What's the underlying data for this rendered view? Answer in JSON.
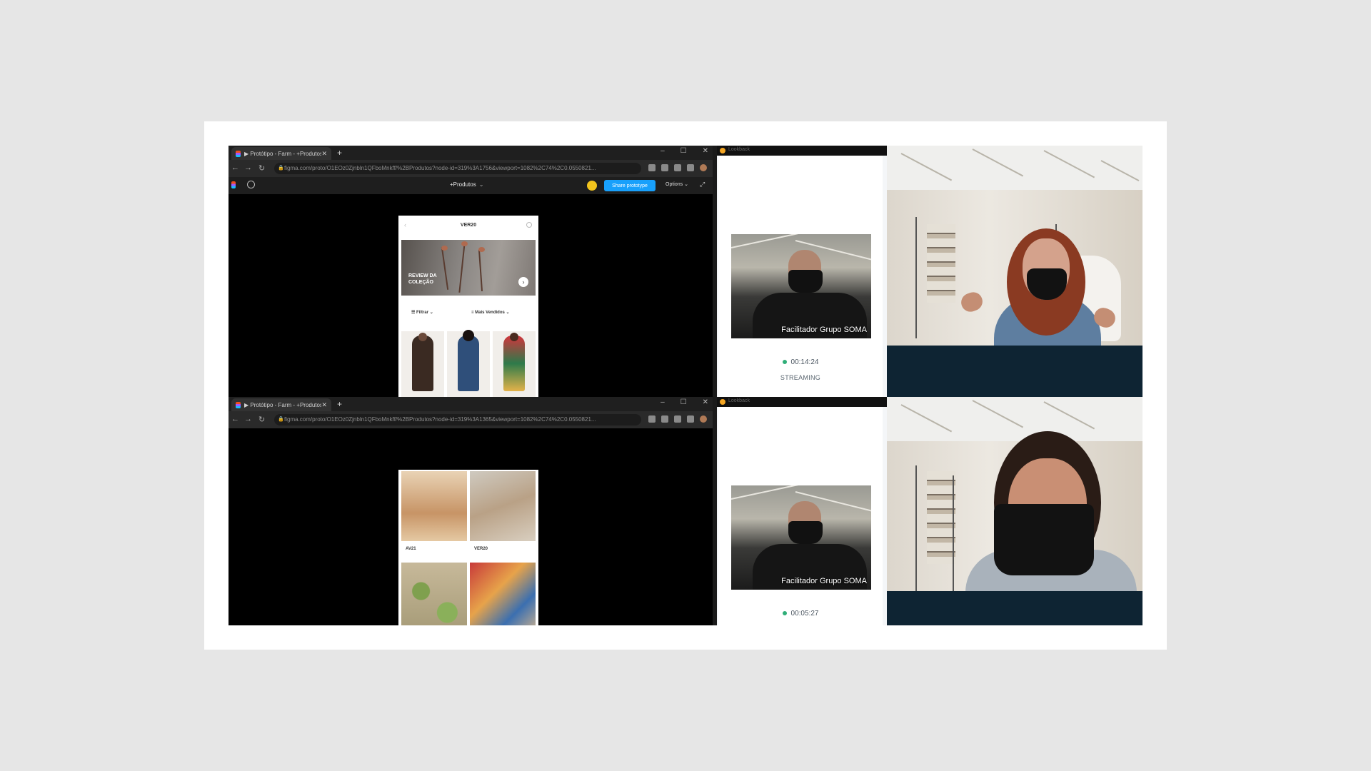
{
  "browser": {
    "tab_title": "▶ Protótipo - Farm - +Produtos",
    "url": "figma.com/proto/O1EOz0Zjnbln1QFboMnkff/%2BProdutos?node-id=319%3A1756&viewport=1082%2C74%2C0.0550821...",
    "url_2": "figma.com/proto/O1EOz0Zjnbln1QFboMnkff/%2BProdutos?node-id=319%3A1365&viewport=1082%2C74%2C0.0550821..."
  },
  "figma": {
    "page_name": "+Produtos",
    "share_label": "Share prototype",
    "options_label": "Options"
  },
  "prototype_1": {
    "header_title": "VER20",
    "banner_text_line1": "REVIEW DA",
    "banner_text_line2": "COLEÇÃO",
    "filter_label": "Filtrar",
    "sort_label": "Mais Vendidos"
  },
  "prototype_2": {
    "label_left": "AV21",
    "label_right": "VER20"
  },
  "lookback": {
    "app_name": "Lookback",
    "caption": "Facilitador Grupo SOMA",
    "timer_1": "00:14:24",
    "timer_2": "00:05:27",
    "status": "STREAMING"
  },
  "colors": {
    "figma_share": "#18a0fb",
    "stream_dot": "#2fae78",
    "participant_bar": "#0e2433"
  }
}
